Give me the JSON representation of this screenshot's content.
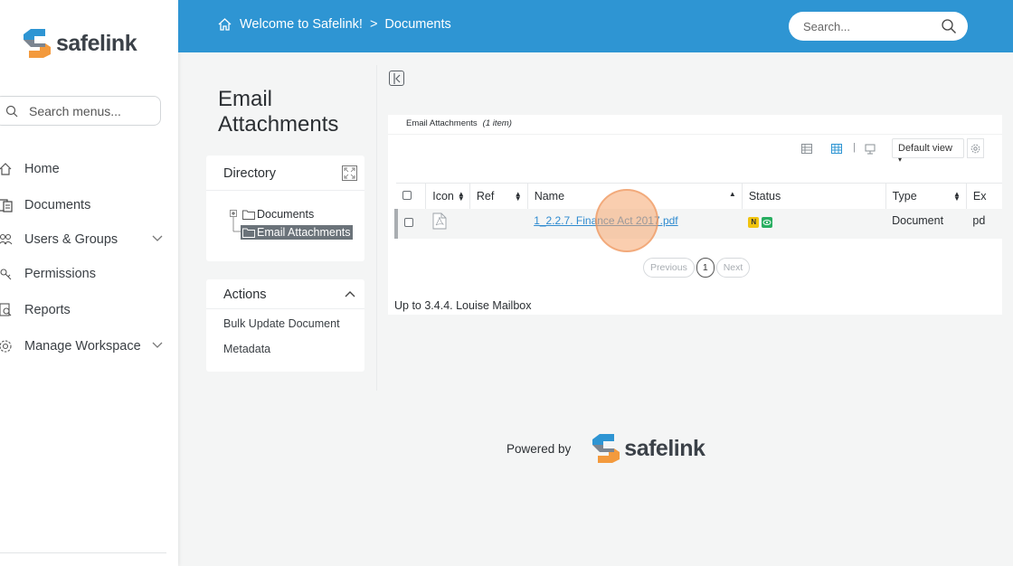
{
  "brand": {
    "name": "safelink",
    "colors": {
      "blue": "#2e95d3",
      "orange": "#f39a3d",
      "dark": "#3b4148"
    }
  },
  "sidebar": {
    "search_placeholder": "Search menus...",
    "items": [
      {
        "label": "Home",
        "icon": "home-icon"
      },
      {
        "label": "Documents",
        "icon": "documents-icon"
      },
      {
        "label": "Users & Groups",
        "icon": "users-icon",
        "expandable": true
      },
      {
        "label": "Permissions",
        "icon": "permissions-icon"
      },
      {
        "label": "Reports",
        "icon": "reports-icon"
      },
      {
        "label": "Manage Workspace",
        "icon": "gear-icon",
        "expandable": true
      }
    ]
  },
  "header": {
    "breadcrumb": {
      "home": "Welcome to Safelink!",
      "separator": ">",
      "current": "Documents"
    },
    "search_placeholder": "Search..."
  },
  "page": {
    "title": "Email Attachments"
  },
  "directory": {
    "title": "Directory",
    "tree": [
      {
        "label": "Documents"
      },
      {
        "label": "Email Attachments",
        "selected": true
      }
    ]
  },
  "actions": {
    "title": "Actions",
    "items": [
      "Bulk Update Document",
      "Metadata"
    ]
  },
  "grid": {
    "title": "Email Attachments",
    "count": "(1 item)",
    "view_label": "Default view",
    "separator": "|",
    "columns": [
      "Icon",
      "Ref",
      "Name",
      "Status",
      "Type",
      "Ex"
    ],
    "rows": [
      {
        "icon": "pdf-icon",
        "ref": "",
        "name": "1_2.2.7. Finance Act 2017.pdf",
        "status": [
          "N",
          "eye"
        ],
        "type": "Document",
        "ext": "pd"
      }
    ],
    "pager": {
      "previous": "Previous",
      "page": "1",
      "next": "Next"
    },
    "footnote": "Up to 3.4.4. Louise Mailbox"
  },
  "footer": {
    "powered_by": "Powered by",
    "brand": "safelink"
  }
}
